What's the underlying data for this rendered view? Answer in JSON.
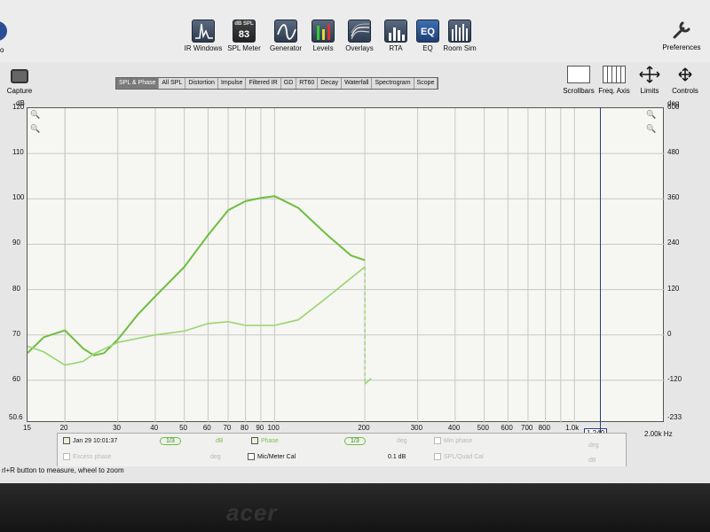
{
  "toolbar": {
    "tools": [
      {
        "id": "ir_windows",
        "label": "IR Windows",
        "icon": "ir-windows-icon"
      },
      {
        "id": "spl_meter",
        "label": "SPL Meter",
        "icon": "spl-meter-icon",
        "value": "83",
        "unit": "dB SPL"
      },
      {
        "id": "generator",
        "label": "Generator",
        "icon": "generator-icon"
      },
      {
        "id": "levels",
        "label": "Levels",
        "icon": "levels-icon"
      },
      {
        "id": "overlays",
        "label": "Overlays",
        "icon": "overlays-icon"
      },
      {
        "id": "rta",
        "label": "RTA",
        "icon": "rta-icon"
      },
      {
        "id": "eq",
        "label": "EQ",
        "icon": "eq-icon",
        "text": "EQ"
      },
      {
        "id": "room_sim",
        "label": "Room Sim",
        "icon": "room-sim-icon"
      }
    ],
    "preferences_label": "Preferences",
    "left_cut_label": "o"
  },
  "capture_label": "Capture",
  "tabs": [
    "SPL & Phase",
    "All SPL",
    "Distortion",
    "Impulse",
    "Filtered IR",
    "GD",
    "RT60",
    "Decay",
    "Waterfall",
    "Spectrogram",
    "Scope"
  ],
  "active_tab": "SPL & Phase",
  "right_tools": [
    "Scrollbars",
    "Freq. Axis",
    "Limits",
    "Controls"
  ],
  "graph": {
    "left_unit": "dB",
    "right_unit": "deg",
    "left_ticks": [
      "120",
      "110",
      "100",
      "90",
      "80",
      "70",
      "60",
      "50.6"
    ],
    "right_ticks": [
      "600",
      "480",
      "360",
      "240",
      "120",
      "0",
      "-120",
      "-233"
    ],
    "x_ticks": [
      "15",
      "20",
      "30",
      "40",
      "50",
      "60",
      "70",
      "80",
      "90",
      "100",
      "200",
      "300",
      "400",
      "500",
      "600",
      "700",
      "800",
      "1.0k"
    ],
    "x_cursor": "1,249",
    "x_max": "2.00k Hz"
  },
  "chart_data": {
    "type": "line",
    "x_scale": "log",
    "xlim": [
      15,
      2000
    ],
    "ylim_left": [
      50.6,
      120
    ],
    "ylim_right": [
      -233,
      600
    ],
    "xlabel": "Hz",
    "ylabel": "dB",
    "y2label": "deg",
    "series": [
      {
        "name": "Jan 29 10:01:37",
        "axis": "left",
        "color": "#6fbd3f",
        "x": [
          15,
          17,
          20,
          23,
          25,
          27,
          30,
          35,
          40,
          50,
          60,
          70,
          80,
          90,
          100,
          120,
          150,
          180,
          200
        ],
        "values": [
          66,
          69.5,
          71,
          67,
          65.5,
          66,
          69,
          74.5,
          78.5,
          85,
          92,
          97.5,
          99.5,
          100.2,
          100.6,
          98,
          92,
          87.5,
          86.5
        ]
      },
      {
        "name": "Phase",
        "axis": "right",
        "color": "#9ad470",
        "x": [
          15,
          17,
          20,
          23,
          25,
          30,
          40,
          50,
          60,
          70,
          80,
          100,
          120,
          150,
          200,
          200,
          210
        ],
        "values": [
          -30,
          -45,
          -80,
          -70,
          -50,
          -20,
          0,
          10,
          30,
          35,
          25,
          25,
          40,
          100,
          180,
          -130,
          -115
        ]
      }
    ]
  },
  "legend": {
    "row1": {
      "measurement": "Jan 29 10:01:37",
      "smoothing": "1/3",
      "unit": "dB",
      "phase_label": "Phase",
      "phase_smoothing": "1/3",
      "phase_unit": "deg",
      "extra": "Min phase",
      "extra_unit": "deg"
    },
    "row2": {
      "excess_phase": "Excess phase",
      "excess_unit": "deg",
      "mic_cal": "Mic/Meter Cal",
      "resolution": "0.1 dB",
      "spl_cal": "SPL/Quad Cal",
      "spl_unit": "dB"
    }
  },
  "status": "rl+R button to measure, wheel to zoom",
  "brand": "acer"
}
